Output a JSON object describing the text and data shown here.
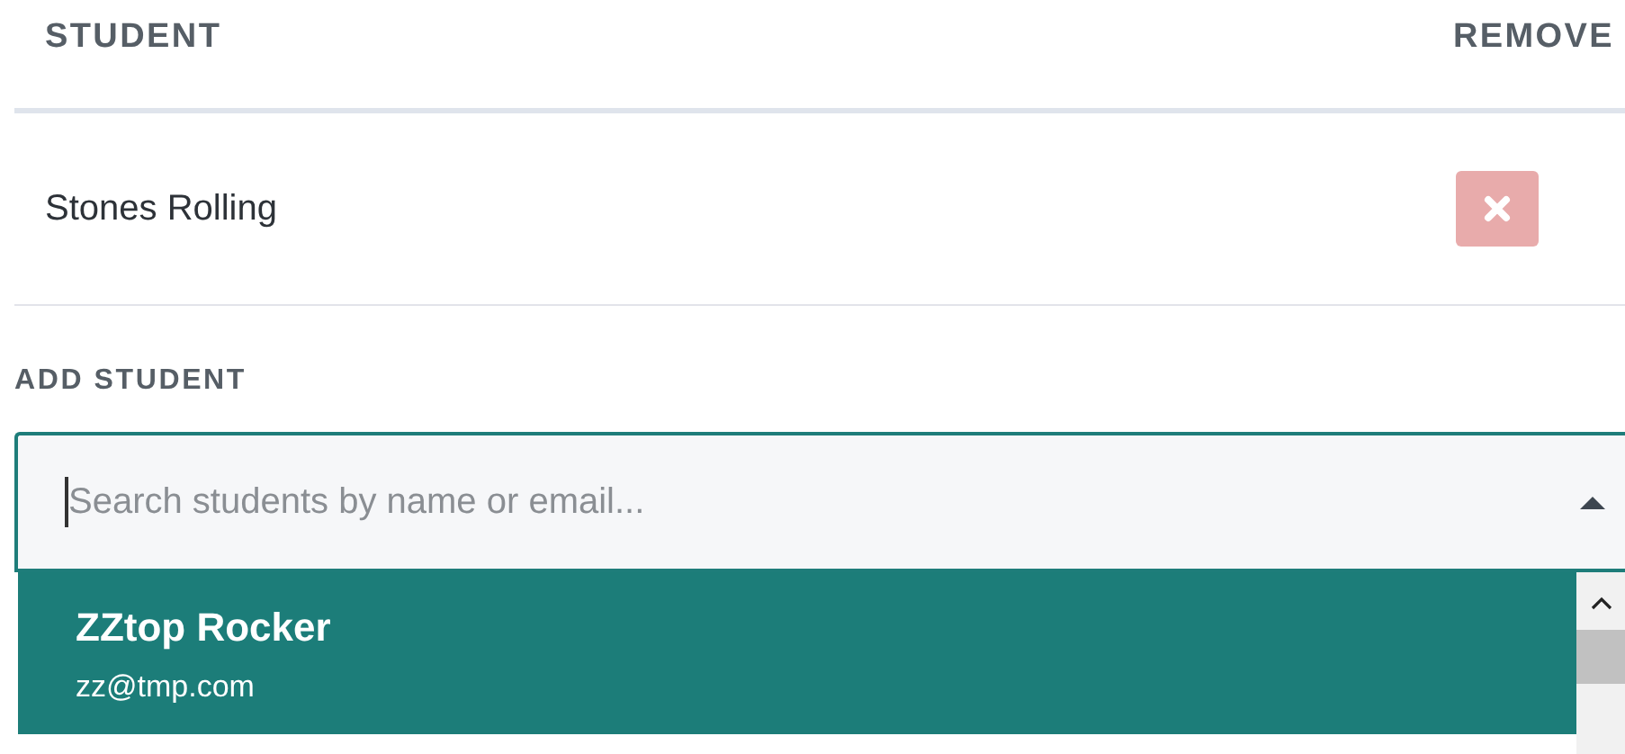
{
  "table": {
    "columns": [
      "STUDENT",
      "REMOVE"
    ],
    "rows": [
      {
        "name": "Stones Rolling"
      }
    ]
  },
  "add_student": {
    "label": "ADD STUDENT",
    "search": {
      "placeholder": "Search students by name or email...",
      "expanded": true
    },
    "options": [
      {
        "name": "ZZtop Rocker",
        "email": "zz@tmp.com",
        "selected": true
      }
    ]
  }
}
